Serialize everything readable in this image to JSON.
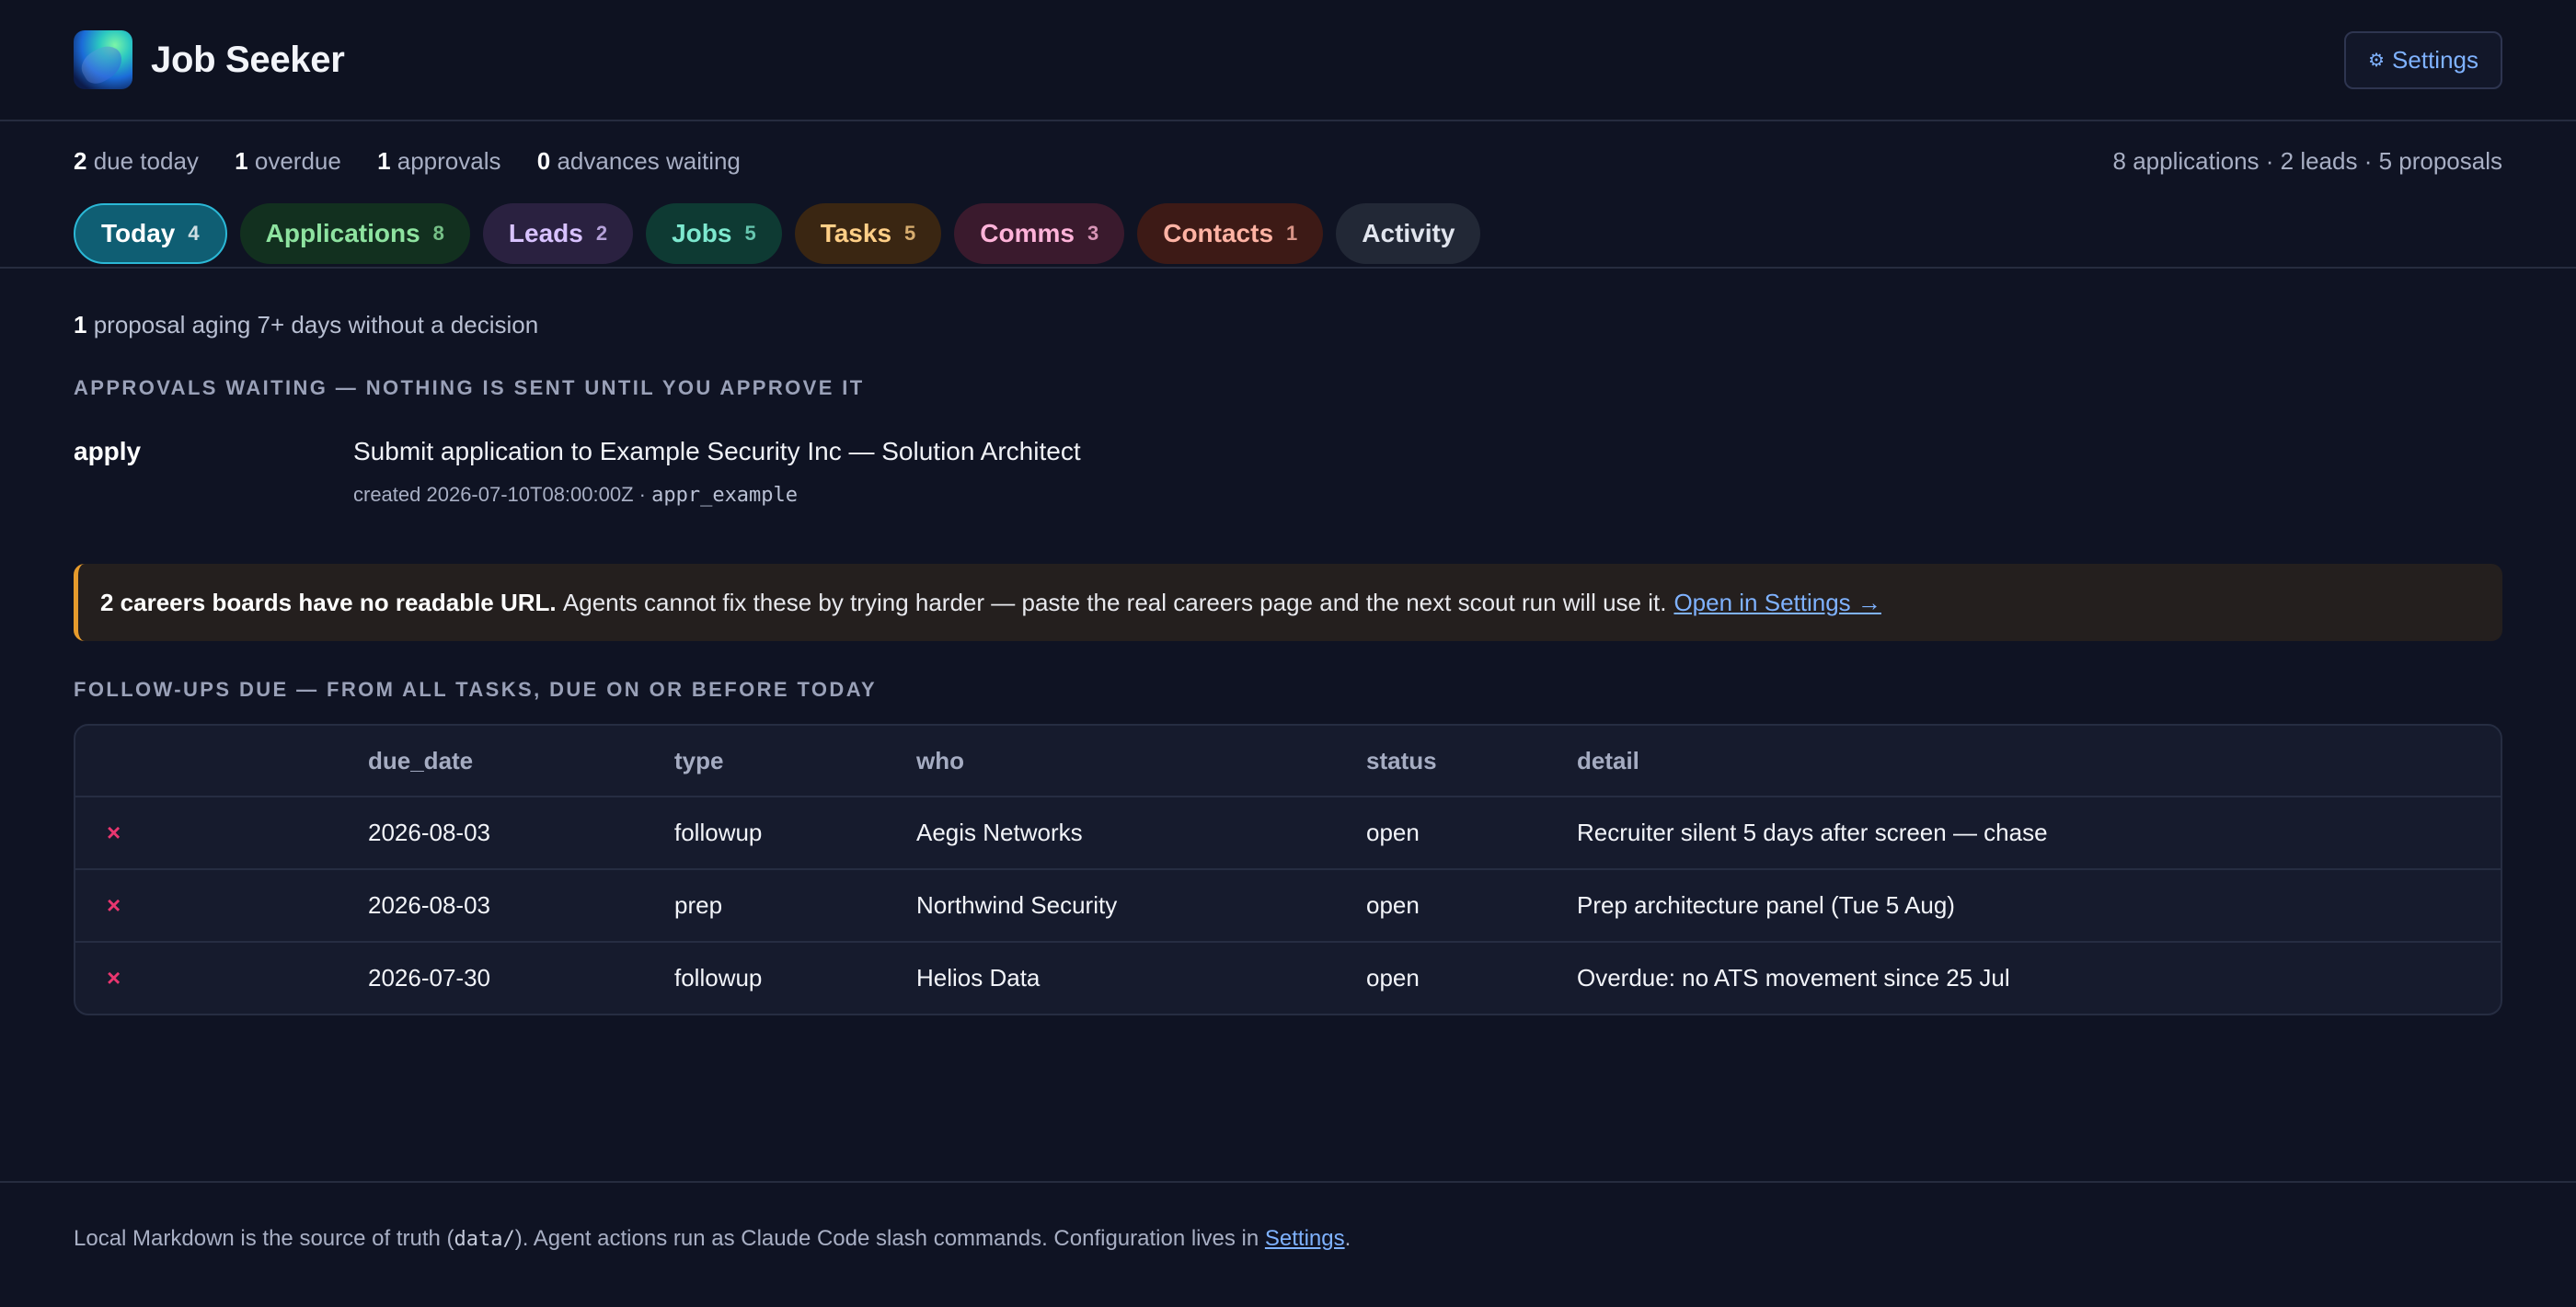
{
  "header": {
    "title": "Job Seeker",
    "settings_label": "Settings",
    "settings_icon": "gear-icon"
  },
  "summary": {
    "due_today_n": "2",
    "due_today_label": "due today",
    "overdue_n": "1",
    "overdue_label": "overdue",
    "approvals_n": "1",
    "approvals_label": "approvals",
    "advances_n": "0",
    "advances_label": "advances waiting",
    "totals": "8 applications · 2 leads · 5 proposals"
  },
  "tabs": [
    {
      "label": "Today",
      "count": "4"
    },
    {
      "label": "Applications",
      "count": "8"
    },
    {
      "label": "Leads",
      "count": "2"
    },
    {
      "label": "Jobs",
      "count": "5"
    },
    {
      "label": "Tasks",
      "count": "5"
    },
    {
      "label": "Comms",
      "count": "3"
    },
    {
      "label": "Contacts",
      "count": "1"
    },
    {
      "label": "Activity",
      "count": ""
    }
  ],
  "aging": {
    "n": "1",
    "text": "proposal aging 7+ days without a decision"
  },
  "approvals": {
    "title": "Approvals waiting — nothing is sent until you approve it",
    "items": [
      {
        "kind": "apply",
        "summary": "Submit application to Example Security Inc — Solution Architect",
        "meta": "created 2026-07-10T08:00:00Z · ",
        "id": "appr_example"
      }
    ]
  },
  "warning": {
    "bold": "2 careers boards have no readable URL.",
    "text": "Agents cannot fix these by trying harder — paste the real careers page and the next scout run will use it.",
    "link": "Open in Settings →",
    "accent": "#e69b2c"
  },
  "followups": {
    "title": "Follow-ups due — from all tasks, due on or before today",
    "columns": [
      "",
      "due_date",
      "type",
      "who",
      "status",
      "detail"
    ],
    "rows": [
      {
        "due_date": "2026-08-03",
        "type": "followup",
        "who": "Aegis Networks",
        "status": "open",
        "detail": "Recruiter silent 5 days after screen — chase"
      },
      {
        "due_date": "2026-08-03",
        "type": "prep",
        "who": "Northwind Security",
        "status": "open",
        "detail": "Prep architecture panel (Tue 5 Aug)"
      },
      {
        "due_date": "2026-07-30",
        "type": "followup",
        "who": "Helios Data",
        "status": "open",
        "detail": "Overdue: no ATS movement since 25 Jul"
      }
    ],
    "dismiss_glyph": "×",
    "dismiss_color": "#e8366f"
  },
  "footer": {
    "t1": "Local Markdown is the source of truth (",
    "code": "data/",
    "t2": "). Agent actions run as Claude Code slash commands. Configuration lives in ",
    "link": "Settings",
    "t3": "."
  }
}
